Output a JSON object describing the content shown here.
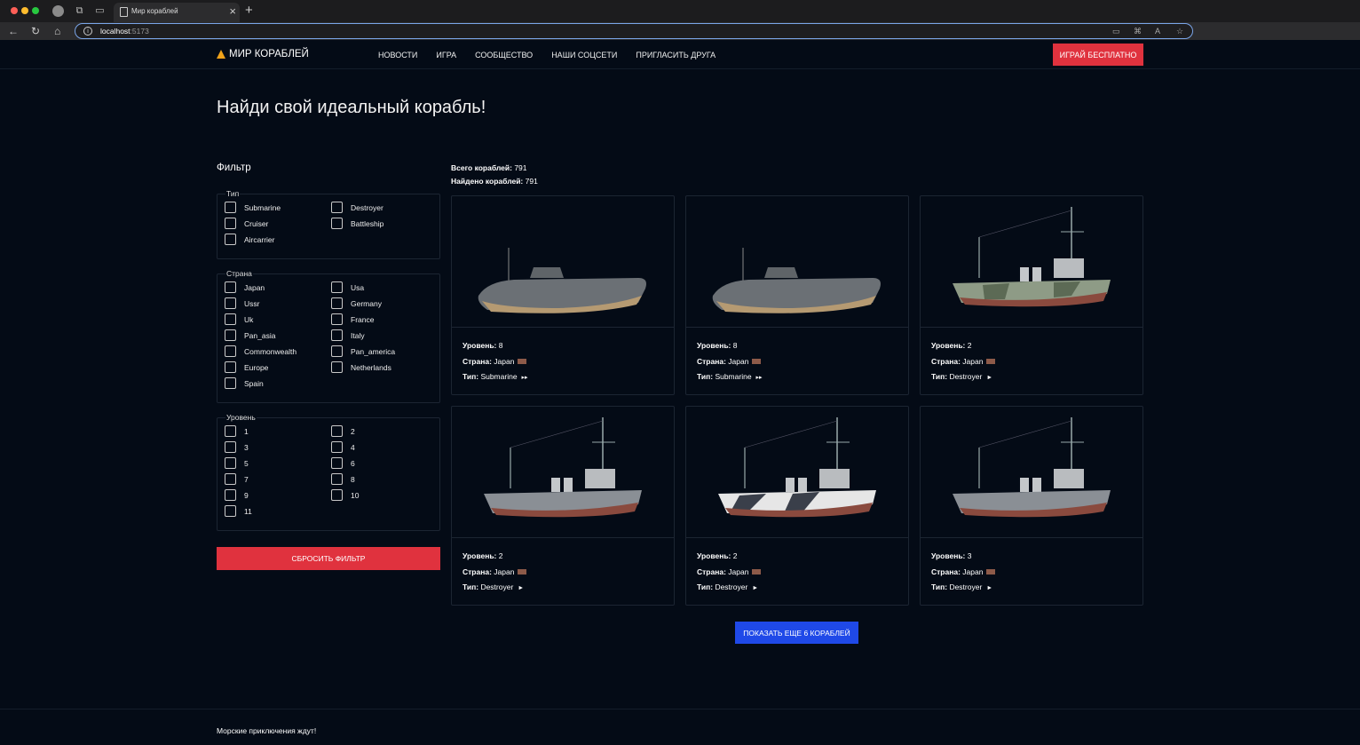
{
  "browser": {
    "tab_title": "Мир кораблей",
    "url_host": "localhost",
    "url_port": ":5173"
  },
  "header": {
    "logo": "МИР КОРАБЛЕЙ",
    "nav": [
      "НОВОСТИ",
      "ИГРА",
      "СООБЩЕСТВО",
      "НАШИ СОЦСЕТИ",
      "ПРИГЛАСИТЬ ДРУГА"
    ],
    "play_button": "ИГРАЙ БЕСПЛАТНО"
  },
  "page_title": "Найди свой идеальный корабль!",
  "filter": {
    "title": "Фильтр",
    "type": {
      "legend": "Тип",
      "options": [
        "Submarine",
        "Destroyer",
        "Cruiser",
        "Battleship",
        "Aircarrier"
      ]
    },
    "country": {
      "legend": "Страна",
      "options": [
        "Japan",
        "Usa",
        "Ussr",
        "Germany",
        "Uk",
        "France",
        "Pan_asia",
        "Italy",
        "Commonwealth",
        "Pan_america",
        "Europe",
        "Netherlands",
        "Spain"
      ]
    },
    "level": {
      "legend": "Уровень",
      "options": [
        "1",
        "2",
        "3",
        "4",
        "5",
        "6",
        "7",
        "8",
        "9",
        "10",
        "11"
      ]
    },
    "reset_button": "СБРОСИТЬ ФИЛЬТР"
  },
  "stats": {
    "total_label": "Всего кораблей:",
    "total_value": "791",
    "found_label": "Найдено кораблей:",
    "found_value": "791"
  },
  "card_labels": {
    "level": "Уровень:",
    "country": "Страна:",
    "type": "Тип:"
  },
  "ships": [
    {
      "level": "8",
      "country": "Japan",
      "type": "Submarine",
      "type_icon": "submarine-icon"
    },
    {
      "level": "8",
      "country": "Japan",
      "type": "Submarine",
      "type_icon": "submarine-icon"
    },
    {
      "level": "2",
      "country": "Japan",
      "type": "Destroyer",
      "type_icon": "destroyer-icon"
    },
    {
      "level": "2",
      "country": "Japan",
      "type": "Destroyer",
      "type_icon": "destroyer-icon"
    },
    {
      "level": "2",
      "country": "Japan",
      "type": "Destroyer",
      "type_icon": "destroyer-icon"
    },
    {
      "level": "3",
      "country": "Japan",
      "type": "Destroyer",
      "type_icon": "destroyer-icon"
    }
  ],
  "show_more_button": "ПОКАЗАТЬ ЕЩЕ 6 КОРАБЛЕЙ",
  "footer_text": "Морские приключения ждут!",
  "colors": {
    "accent_red": "#e0323e",
    "accent_blue": "#1f49e8",
    "background": "#040b16"
  }
}
